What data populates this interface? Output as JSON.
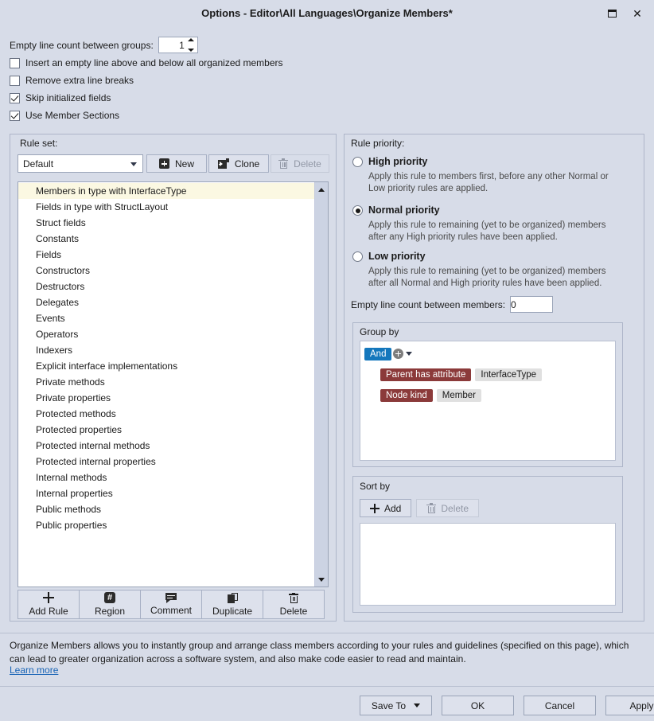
{
  "window": {
    "title": "Options - Editor\\All Languages\\Organize Members*",
    "restore_icon": "restore-icon",
    "close_icon": "close-icon"
  },
  "top_options": {
    "empty_line_groups_label": "Empty line count between groups:",
    "empty_line_groups_value": "1",
    "checkboxes": [
      {
        "label": "Insert an empty line above and below all organized members",
        "checked": false
      },
      {
        "label": "Remove extra line breaks",
        "checked": false
      },
      {
        "label": "Skip initialized fields",
        "checked": true
      },
      {
        "label": "Use Member Sections",
        "checked": true
      }
    ]
  },
  "rule_set": {
    "label": "Rule set:",
    "selected": "Default",
    "buttons": [
      {
        "label": "New",
        "icon": "plus-box-icon",
        "disabled": false
      },
      {
        "label": "Clone",
        "icon": "clone-icon",
        "disabled": false
      },
      {
        "label": "Delete",
        "icon": "trash-icon",
        "disabled": true
      }
    ],
    "rules": [
      "Members in type with InterfaceType",
      "Fields in type with StructLayout",
      "Struct fields",
      "Constants",
      "Fields",
      "Constructors",
      "Destructors",
      "Delegates",
      "Events",
      "Operators",
      "Indexers",
      "Explicit interface implementations",
      "Private methods",
      "Private properties",
      "Protected methods",
      "Protected properties",
      "Protected internal methods",
      "Protected internal properties",
      "Internal methods",
      "Internal properties",
      "Public methods",
      "Public properties"
    ],
    "selected_rule_index": 0,
    "toolbar": [
      {
        "label": "Add Rule",
        "icon": "plus-icon"
      },
      {
        "label": "Region",
        "icon": "hash-icon"
      },
      {
        "label": "Comment",
        "icon": "comment-icon"
      },
      {
        "label": "Duplicate",
        "icon": "duplicate-icon"
      },
      {
        "label": "Delete",
        "icon": "trash-icon"
      }
    ]
  },
  "rule_priority": {
    "title": "Rule priority:",
    "options": [
      {
        "label": "High priority",
        "description": "Apply this rule to members first, before any other Normal or Low priority rules are applied.",
        "selected": false
      },
      {
        "label": "Normal priority",
        "description": "Apply this rule to remaining (yet to be organized) members after any High priority rules have been applied.",
        "selected": true
      },
      {
        "label": "Low priority",
        "description": "Apply this rule to remaining (yet to be organized) members after all Normal and High priority rules have been applied.",
        "selected": false
      }
    ],
    "empty_line_members_label": "Empty line count between members:",
    "empty_line_members_value": "0"
  },
  "group_by": {
    "title": "Group by",
    "operator": "And",
    "add_icon": "plus-circle-icon",
    "conditions": [
      {
        "key": "Parent has attribute",
        "value": "InterfaceType"
      },
      {
        "key": "Node kind",
        "value": "Member"
      }
    ]
  },
  "sort_by": {
    "title": "Sort by",
    "buttons": [
      {
        "label": "Add",
        "icon": "plus-icon",
        "disabled": false
      },
      {
        "label": "Delete",
        "icon": "trash-icon",
        "disabled": true
      }
    ],
    "items": []
  },
  "footer": {
    "description": "Organize Members allows you to instantly group and arrange class members according to your rules and guidelines (specified on this page), which can lead to greater organization across a software system, and also make code easier to read and maintain.",
    "learn_more": "Learn more",
    "buttons": [
      {
        "label": "Save To",
        "has_caret": true
      },
      {
        "label": "OK",
        "has_caret": false
      },
      {
        "label": "Cancel",
        "has_caret": false
      },
      {
        "label": "Apply",
        "has_caret": false
      }
    ]
  },
  "colors": {
    "dialog_background": "#d7dce8",
    "accent_blue": "#1477bc",
    "chip_key_red": "#8b3a3a",
    "chip_value_gray": "#e0e0e0",
    "selection_yellow": "#fbf8e2",
    "link_blue": "#1763b5"
  }
}
